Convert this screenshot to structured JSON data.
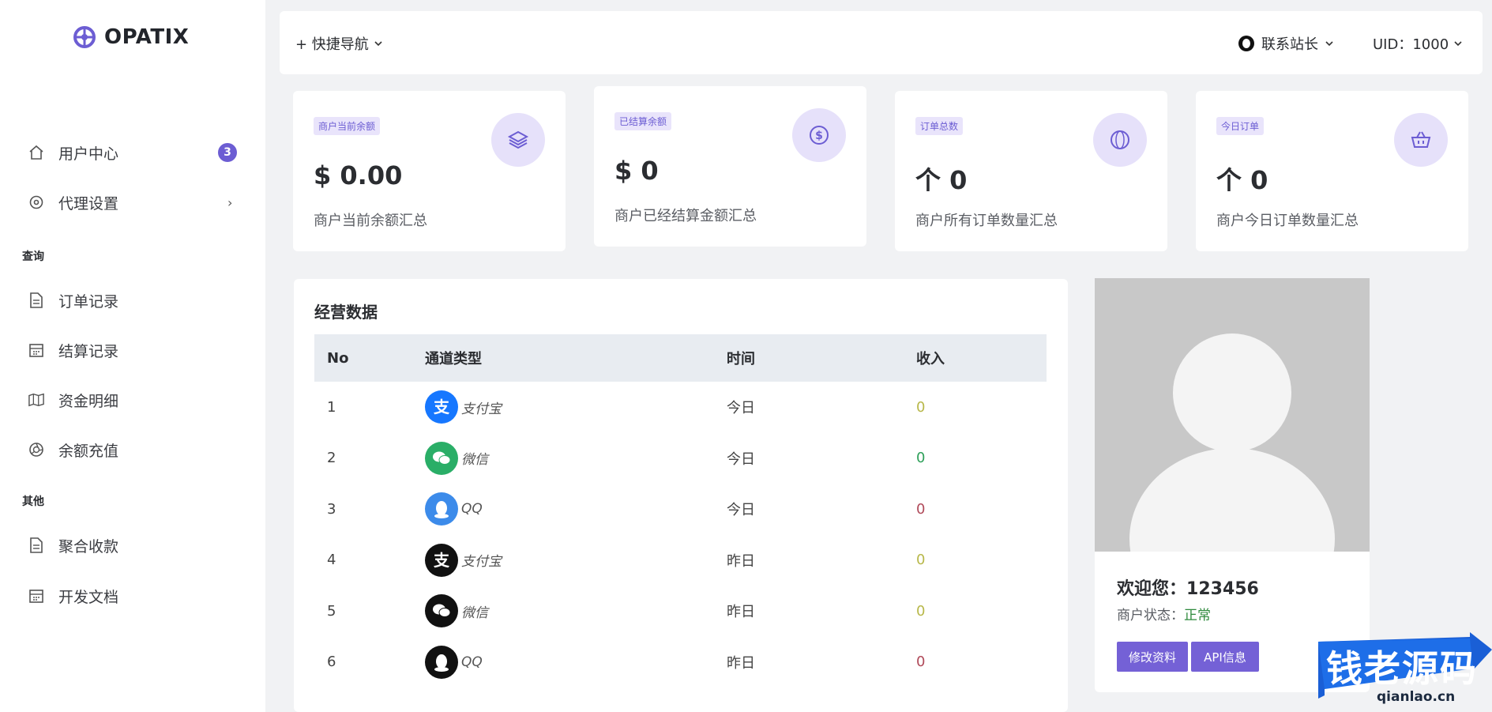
{
  "brand": {
    "name": "OPATIX",
    "accent": "#6c5dd3"
  },
  "sidebar": {
    "items_top": [
      {
        "label": "用户中心",
        "icon": "home-icon",
        "badge": "3"
      },
      {
        "label": "代理设置",
        "icon": "settings-icon",
        "arrow": "›"
      }
    ],
    "section_query": "查询",
    "items_query": [
      {
        "label": "订单记录",
        "icon": "document-icon"
      },
      {
        "label": "结算记录",
        "icon": "calendar-icon"
      },
      {
        "label": "资金明细",
        "icon": "map-icon"
      },
      {
        "label": "余额充值",
        "icon": "aperture-icon"
      }
    ],
    "section_other": "其他",
    "items_other": [
      {
        "label": "聚合收款",
        "icon": "document-icon"
      },
      {
        "label": "开发文档",
        "icon": "calendar-icon"
      }
    ]
  },
  "topbar": {
    "quick_nav": "+ 快捷导航",
    "contact": "联系站长",
    "uid": "UID：1000"
  },
  "stats": [
    {
      "tag": "商户当前余额",
      "value": "$ 0.00",
      "desc": "商户当前余额汇总",
      "icon": "layers-icon"
    },
    {
      "tag": "已结算余额",
      "value": "$ 0",
      "desc": "商户已经结算金额汇总",
      "icon": "dollar-circle-icon"
    },
    {
      "tag": "订单总数",
      "value": "个 0",
      "desc": "商户所有订单数量汇总",
      "icon": "globe-icon"
    },
    {
      "tag": "今日订单",
      "value": "个 0",
      "desc": "商户今日订单数量汇总",
      "icon": "basket-icon"
    }
  ],
  "business": {
    "title": "经营数据",
    "headers": {
      "no": "No",
      "channel": "通道类型",
      "time": "时间",
      "income": "收入"
    },
    "rows": [
      {
        "no": "1",
        "channel": "支付宝",
        "icon": "alipay-icon",
        "time": "今日",
        "income": "0",
        "income_color": "#b8b84a",
        "icon_color": "#1677ff"
      },
      {
        "no": "2",
        "channel": "微信",
        "icon": "wechat-icon",
        "time": "今日",
        "income": "0",
        "income_color": "#2fa05a",
        "icon_color": "#2aae67"
      },
      {
        "no": "3",
        "channel": "QQ",
        "icon": "qq-icon",
        "time": "今日",
        "income": "0",
        "income_color": "#b04a5a",
        "icon_color": "#3c8bea"
      },
      {
        "no": "4",
        "channel": "支付宝",
        "icon": "alipay-icon",
        "time": "昨日",
        "income": "0",
        "income_color": "#b8b84a",
        "icon_color": "#111111"
      },
      {
        "no": "5",
        "channel": "微信",
        "icon": "wechat-icon",
        "time": "昨日",
        "income": "0",
        "income_color": "#b8b84a",
        "icon_color": "#111111"
      },
      {
        "no": "6",
        "channel": "QQ",
        "icon": "qq-icon",
        "time": "昨日",
        "income": "0",
        "income_color": "#b04a5a",
        "icon_color": "#111111"
      }
    ]
  },
  "profile": {
    "welcome_label": "欢迎您：",
    "username": "123456",
    "status_label": "商户状态：",
    "status_value": "正常",
    "edit_button": "修改资料",
    "api_button": "API信息"
  },
  "watermark": {
    "text": "钱老源码",
    "sub": "qianlao.cn"
  }
}
